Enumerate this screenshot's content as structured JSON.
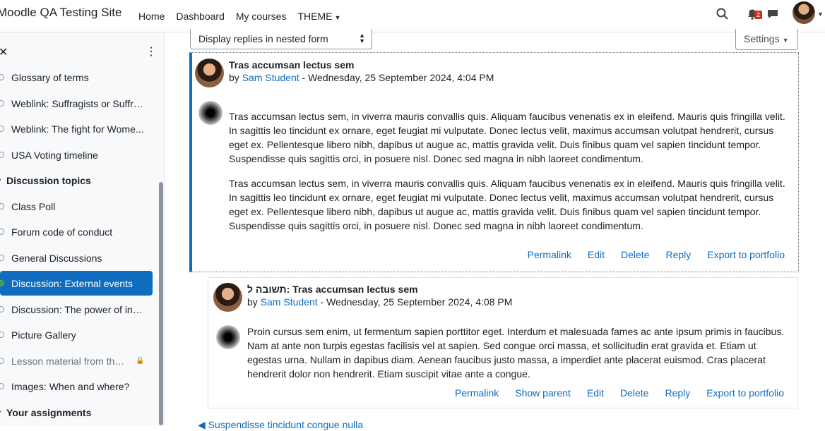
{
  "navbar": {
    "site_name": "Moodle QA Testing Site",
    "links": [
      "Home",
      "Dashboard",
      "My courses",
      "THEME"
    ],
    "notification_count": "2"
  },
  "drawer": {
    "items": [
      {
        "label": "Glossary of terms",
        "type": "item"
      },
      {
        "label": "Weblink: Suffragists or Suffra...",
        "type": "item"
      },
      {
        "label": "Weblink: The fight for Wome...",
        "type": "item"
      },
      {
        "label": "USA Voting timeline",
        "type": "item"
      },
      {
        "label": "Discussion topics",
        "type": "section"
      },
      {
        "label": "Class Poll",
        "type": "item"
      },
      {
        "label": "Forum code of conduct",
        "type": "item"
      },
      {
        "label": "General Discussions",
        "type": "item"
      },
      {
        "label": "Discussion: External events",
        "type": "active"
      },
      {
        "label": "Discussion: The power of indi...",
        "type": "item"
      },
      {
        "label": "Picture Gallery",
        "type": "item"
      },
      {
        "label": "Lesson material from the ...",
        "type": "locked"
      },
      {
        "label": "Images: When and where?",
        "type": "item"
      },
      {
        "label": "Your assignments",
        "type": "section"
      }
    ]
  },
  "controls": {
    "display_mode": "Display replies in nested form",
    "settings_label": "Settings"
  },
  "posts": [
    {
      "subject": "Tras accumsan lectus sem",
      "by": "by",
      "author": "Sam Student",
      "date": "- Wednesday, 25 September 2024, 4:04 PM",
      "paragraphs": [
        "Tras accumsan lectus sem, in viverra mauris convallis quis. Aliquam faucibus venenatis ex in eleifend. Mauris quis fringilla velit. In sagittis leo tincidunt ex ornare, eget feugiat mi vulputate. Donec lectus velit, maximus accumsan volutpat hendrerit, cursus eget ex. Pellentesque libero nibh, dapibus ut augue ac, mattis gravida velit. Duis finibus quam vel sapien tincidunt tempor. Suspendisse quis sagittis orci, in posuere nisl. Donec sed magna in nibh laoreet condimentum.",
        "Tras accumsan lectus sem, in viverra mauris convallis quis. Aliquam faucibus venenatis ex in eleifend. Mauris quis fringilla velit. In sagittis leo tincidunt ex ornare, eget feugiat mi vulputate. Donec lectus velit, maximus accumsan volutpat hendrerit, cursus eget ex. Pellentesque libero nibh, dapibus ut augue ac, mattis gravida velit. Duis finibus quam vel sapien tincidunt tempor. Suspendisse quis sagittis orci, in posuere nisl. Donec sed magna in nibh laoreet condimentum."
      ],
      "actions": [
        "Permalink",
        "Edit",
        "Delete",
        "Reply",
        "Export to portfolio"
      ]
    },
    {
      "subject": "תשובה ל: Tras accumsan lectus sem",
      "by": "by",
      "author": "Sam Student",
      "date": "- Wednesday, 25 September 2024, 4:08 PM",
      "paragraphs": [
        "Proin cursus sem enim, ut fermentum sapien porttitor eget. Interdum et malesuada fames ac ante ipsum primis in faucibus. Nam at ante non turpis egestas facilisis vel at sapien. Sed congue orci massa, et sollicitudin erat gravida et. Etiam ut egestas urna. Nullam in dapibus diam. Aenean faucibus justo massa, a imperdiet ante placerat euismod. Cras placerat hendrerit dolor non hendrerit. Etiam suscipit vitae ante a congue."
      ],
      "actions": [
        "Permalink",
        "Show parent",
        "Edit",
        "Delete",
        "Reply",
        "Export to portfolio"
      ]
    }
  ],
  "bottom_link": "◀ Suspendisse tincidunt congue nulla",
  "icons": {
    "search": "search-icon",
    "bell": "bell-icon",
    "messages": "chat-icon",
    "close": "close-icon",
    "kebab": "kebab-icon"
  },
  "colors": {
    "accent": "#0f6cbf",
    "badge": "#ca3120",
    "active_item_bg": "#0f6cbf"
  }
}
